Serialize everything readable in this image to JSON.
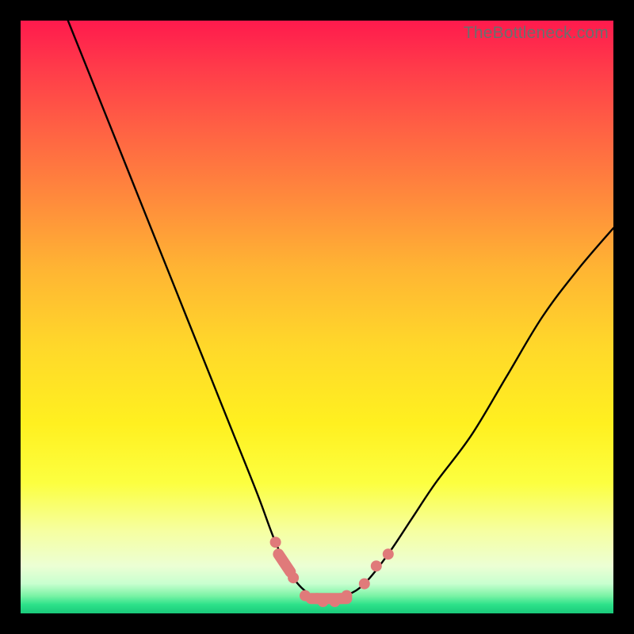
{
  "watermark": "TheBottleneck.com",
  "chart_data": {
    "type": "line",
    "title": "",
    "xlabel": "",
    "ylabel": "",
    "xlim": [
      0,
      100
    ],
    "ylim": [
      0,
      100
    ],
    "series": [
      {
        "name": "bottleneck-curve",
        "x": [
          8,
          12,
          16,
          20,
          24,
          28,
          32,
          36,
          40,
          43,
          46,
          49,
          51,
          53,
          55,
          58,
          62,
          66,
          70,
          76,
          82,
          88,
          94,
          100
        ],
        "values": [
          100,
          90,
          80,
          70,
          60,
          50,
          40,
          30,
          20,
          12,
          6,
          3,
          2,
          2,
          3,
          5,
          10,
          16,
          22,
          30,
          40,
          50,
          58,
          65
        ]
      }
    ],
    "markers": {
      "name": "highlight-dots",
      "color": "#e07a7a",
      "points": [
        {
          "x": 43,
          "y": 12
        },
        {
          "x": 46,
          "y": 6
        },
        {
          "x": 48,
          "y": 3
        },
        {
          "x": 50,
          "y": 2.5
        },
        {
          "x": 51,
          "y": 2
        },
        {
          "x": 53,
          "y": 2
        },
        {
          "x": 54,
          "y": 2.5
        },
        {
          "x": 55,
          "y": 3
        },
        {
          "x": 58,
          "y": 5
        },
        {
          "x": 60,
          "y": 8
        },
        {
          "x": 62,
          "y": 10
        }
      ]
    },
    "colors": {
      "curve": "#000000",
      "marker": "#e07a7a",
      "background_top": "#ff1a4d",
      "background_bottom": "#19c97a",
      "frame": "#000000"
    }
  }
}
